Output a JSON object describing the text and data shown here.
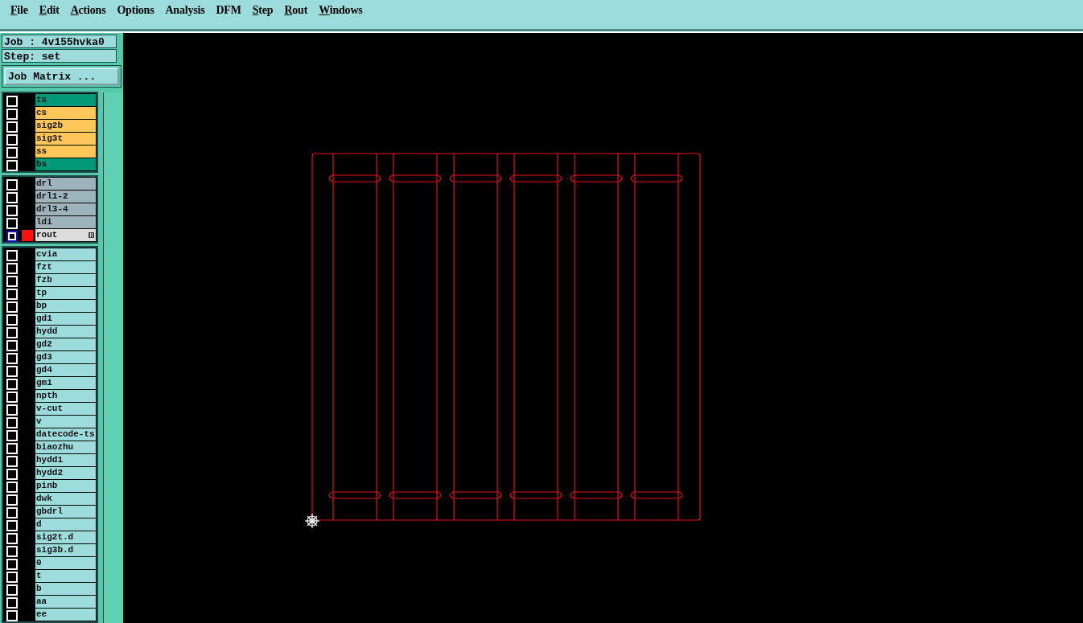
{
  "menu": [
    {
      "label": "File",
      "mnemonic": true
    },
    {
      "label": "Edit",
      "mnemonic": true
    },
    {
      "label": "Actions",
      "mnemonic": true
    },
    {
      "label": "Options",
      "mnemonic": false
    },
    {
      "label": "Analysis",
      "mnemonic": false
    },
    {
      "label": "DFM",
      "mnemonic": false
    },
    {
      "label": "Step",
      "mnemonic": true
    },
    {
      "label": "Rout",
      "mnemonic": true
    },
    {
      "label": "Windows",
      "mnemonic": true
    }
  ],
  "job": "Job : 4v155hvka0",
  "step": "Step: set",
  "job_matrix_button": "Job Matrix ...",
  "layer_groups": [
    {
      "layers": [
        {
          "name": "ts",
          "color": "#009977",
          "selected": false
        },
        {
          "name": "cs",
          "color": "#ffc65a",
          "selected": false
        },
        {
          "name": "sig2b",
          "color": "#ffc65a",
          "selected": false
        },
        {
          "name": "sig3t",
          "color": "#ffc65a",
          "selected": false
        },
        {
          "name": "ss",
          "color": "#ffc65a",
          "selected": false
        },
        {
          "name": "bs",
          "color": "#009977",
          "selected": false
        }
      ]
    },
    {
      "layers": [
        {
          "name": "drl",
          "color": "#9eb4bc",
          "selected": false
        },
        {
          "name": "drl1-2",
          "color": "#9eb4bc",
          "selected": false
        },
        {
          "name": "drl3-4",
          "color": "#9eb4bc",
          "selected": false
        },
        {
          "name": "ldi",
          "color": "#9eb4bc",
          "selected": false
        },
        {
          "name": "rout",
          "color": "#dcdcdc",
          "selected": true
        }
      ]
    },
    {
      "layers": [
        {
          "name": "cvia",
          "color": "#9ddcdc",
          "selected": false
        },
        {
          "name": "fzt",
          "color": "#9ddcdc",
          "selected": false
        },
        {
          "name": "fzb",
          "color": "#9ddcdc",
          "selected": false
        },
        {
          "name": "tp",
          "color": "#9ddcdc",
          "selected": false
        },
        {
          "name": "bp",
          "color": "#9ddcdc",
          "selected": false
        },
        {
          "name": "gd1",
          "color": "#9ddcdc",
          "selected": false
        },
        {
          "name": "hydd",
          "color": "#9ddcdc",
          "selected": false
        },
        {
          "name": "gd2",
          "color": "#9ddcdc",
          "selected": false
        },
        {
          "name": "gd3",
          "color": "#9ddcdc",
          "selected": false
        },
        {
          "name": "gd4",
          "color": "#9ddcdc",
          "selected": false
        },
        {
          "name": "gm1",
          "color": "#9ddcdc",
          "selected": false
        },
        {
          "name": "npth",
          "color": "#9ddcdc",
          "selected": false
        },
        {
          "name": "v-cut",
          "color": "#9ddcdc",
          "selected": false
        },
        {
          "name": "v",
          "color": "#9ddcdc",
          "selected": false
        },
        {
          "name": "datecode-ts",
          "color": "#9ddcdc",
          "selected": false
        },
        {
          "name": "biaozhu",
          "color": "#9ddcdc",
          "selected": false
        },
        {
          "name": "hydd1",
          "color": "#9ddcdc",
          "selected": false
        },
        {
          "name": "hydd2",
          "color": "#9ddcdc",
          "selected": false
        },
        {
          "name": "pinb",
          "color": "#9ddcdc",
          "selected": false
        },
        {
          "name": "dwk",
          "color": "#9ddcdc",
          "selected": false
        },
        {
          "name": "gbdrl",
          "color": "#9ddcdc",
          "selected": false
        },
        {
          "name": "d",
          "color": "#9ddcdc",
          "selected": false
        },
        {
          "name": "sig2t.d",
          "color": "#9ddcdc",
          "selected": false
        },
        {
          "name": "sig3b.d",
          "color": "#9ddcdc",
          "selected": false
        },
        {
          "name": "0",
          "color": "#9ddcdc",
          "selected": false
        },
        {
          "name": "t",
          "color": "#9ddcdc",
          "selected": false
        },
        {
          "name": "b",
          "color": "#9ddcdc",
          "selected": false
        },
        {
          "name": "aa",
          "color": "#9ddcdc",
          "selected": false
        },
        {
          "name": "ee",
          "color": "#9ddcdc",
          "selected": false
        }
      ]
    }
  ]
}
